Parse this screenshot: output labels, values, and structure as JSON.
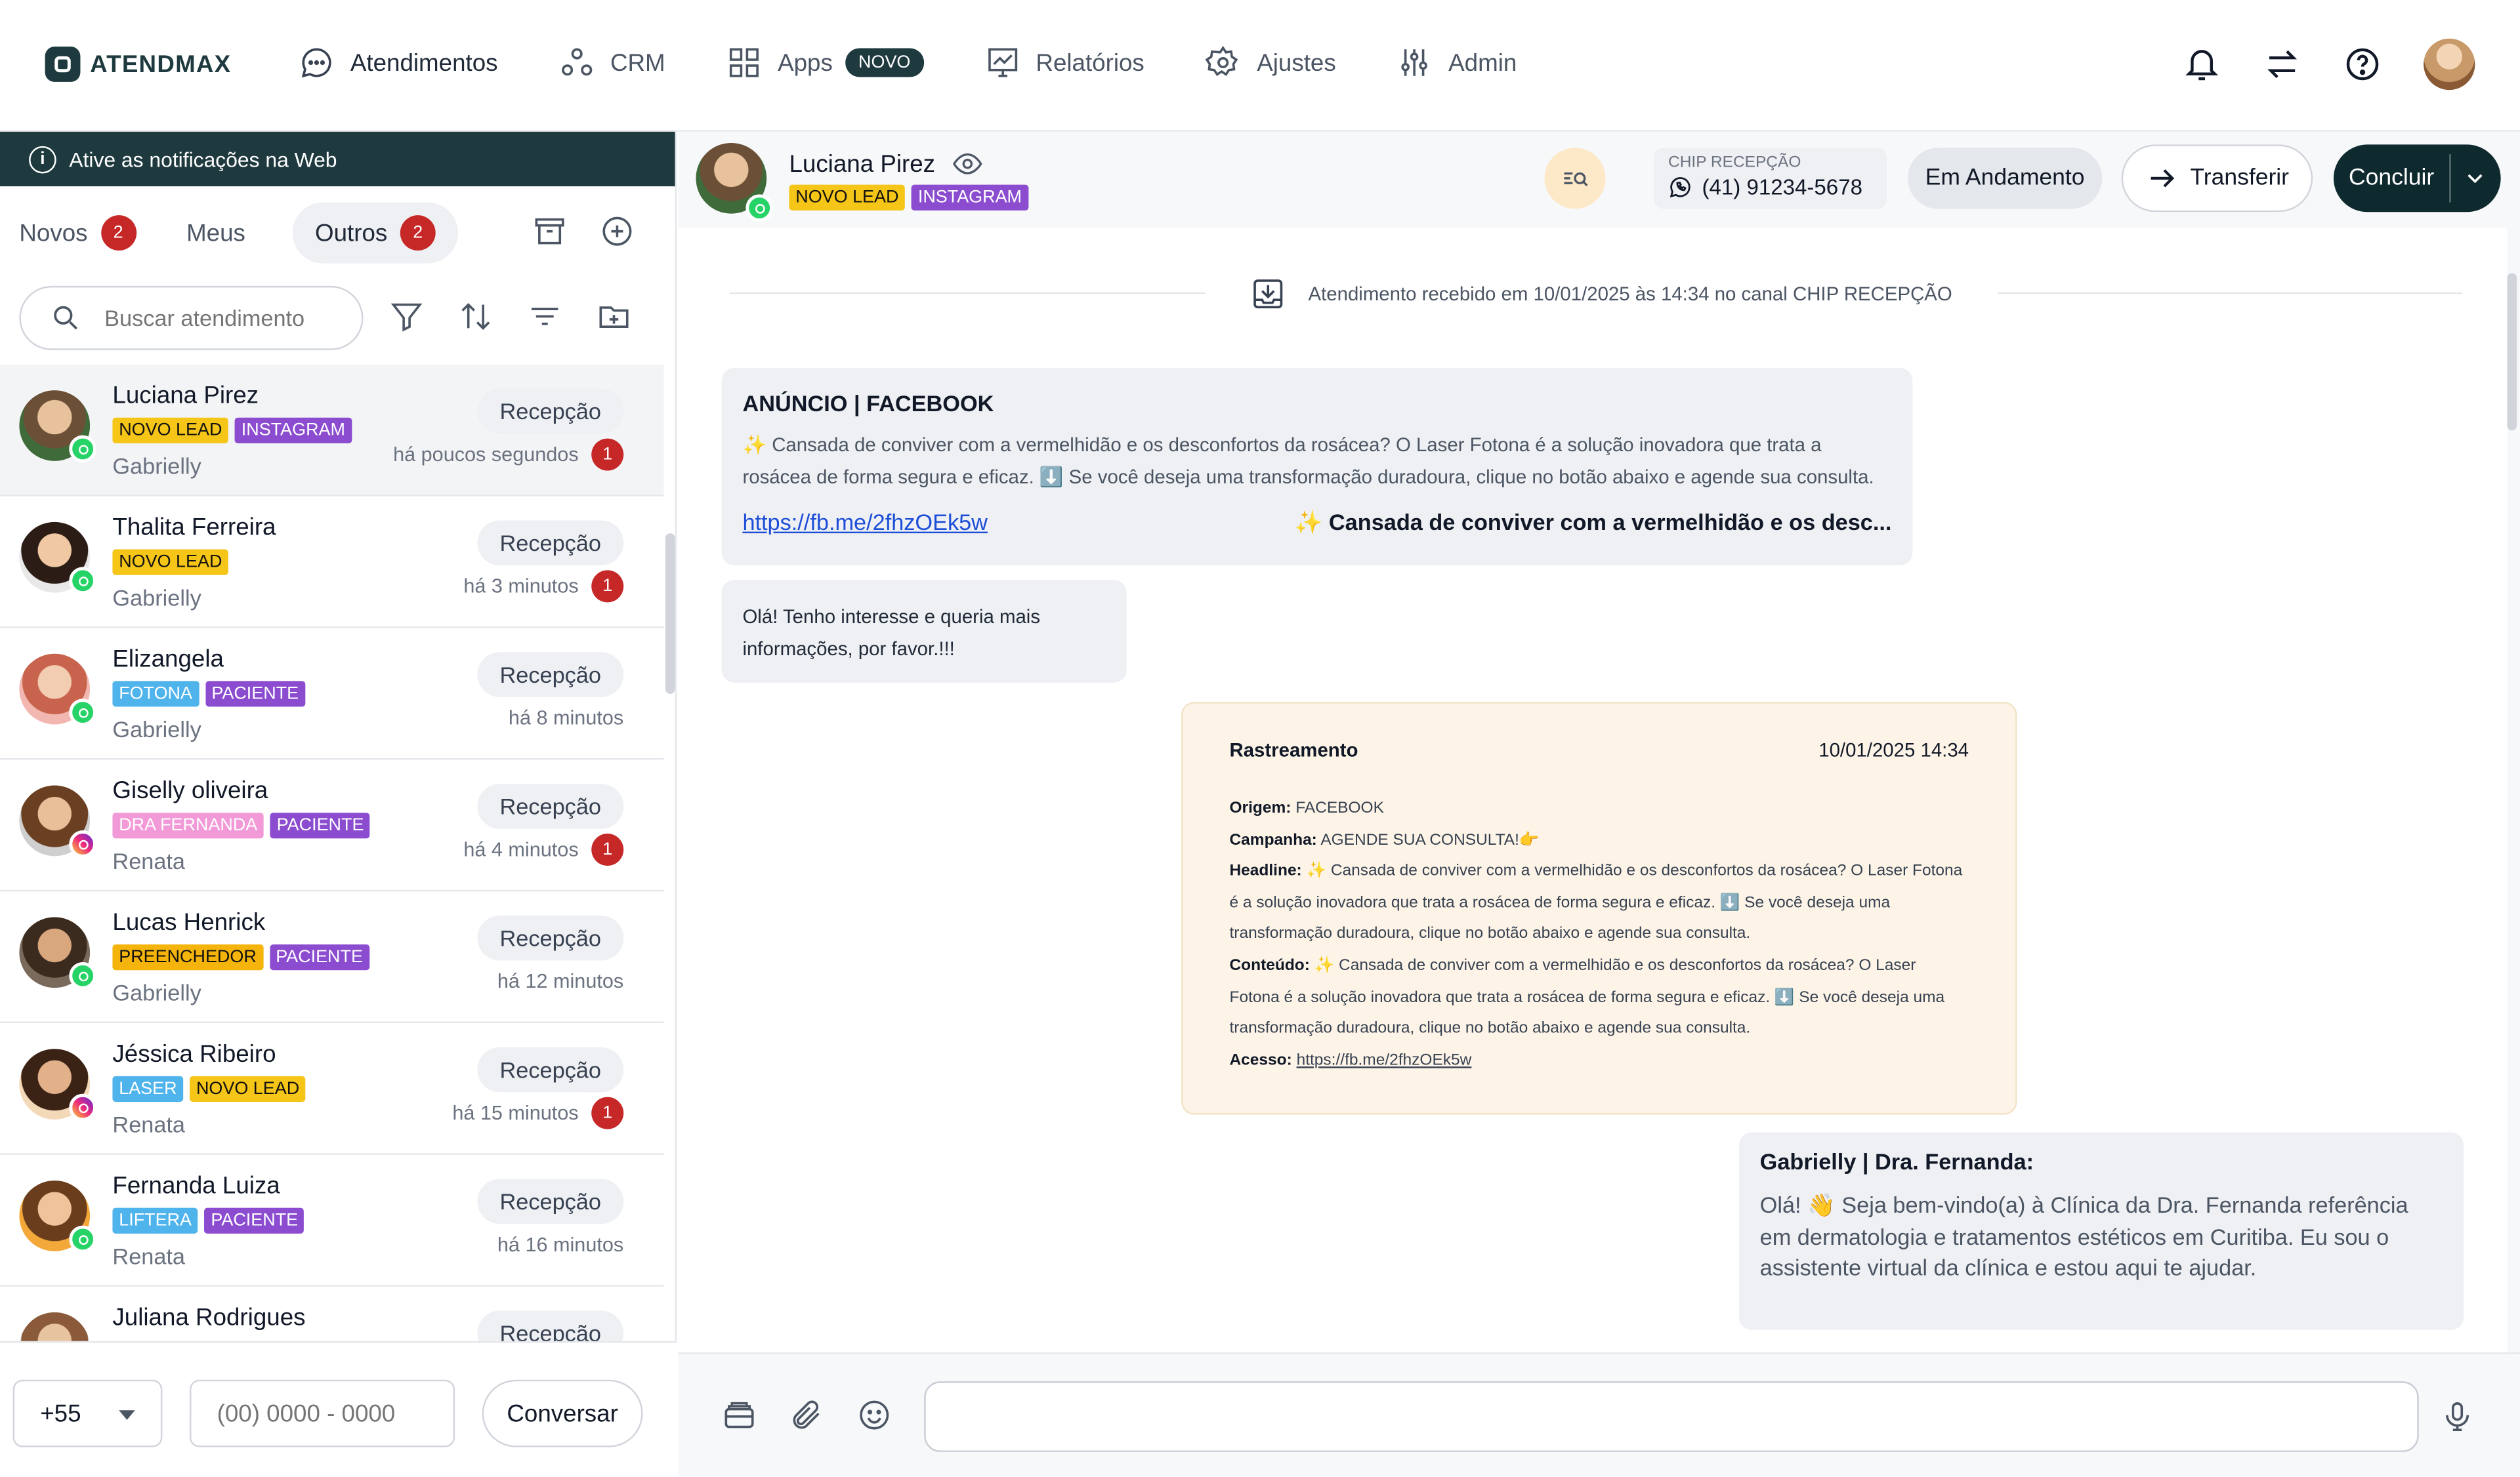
{
  "app": {
    "logo_text": "ATENDMAX"
  },
  "nav": {
    "items": [
      {
        "label": "Atendimentos",
        "icon": "chat-bubble-icon"
      },
      {
        "label": "CRM",
        "icon": "nodes-icon"
      },
      {
        "label": "Apps",
        "icon": "grid-icon",
        "badge": "NOVO"
      },
      {
        "label": "Relatórios",
        "icon": "chart-icon"
      },
      {
        "label": "Ajustes",
        "icon": "gear-icon"
      },
      {
        "label": "Admin",
        "icon": "sliders-icon"
      }
    ]
  },
  "left": {
    "notification": "Ative as notificações na Web",
    "tabs": [
      {
        "label": "Novos",
        "count": "2"
      },
      {
        "label": "Meus"
      },
      {
        "label": "Outros",
        "count": "2"
      }
    ],
    "search_placeholder": "Buscar atendimento",
    "conversations": [
      {
        "name": "Luciana Pirez",
        "tags": [
          "NOVO LEAD",
          "INSTAGRAM"
        ],
        "agent": "Gabrielly",
        "queue": "Recepção",
        "time": "há poucos segundos",
        "unread": "1",
        "channel": "whatsapp"
      },
      {
        "name": "Thalita Ferreira",
        "tags": [
          "NOVO LEAD"
        ],
        "agent": "Gabrielly",
        "queue": "Recepção",
        "time": "há 3 minutos",
        "unread": "1",
        "channel": "whatsapp"
      },
      {
        "name": "Elizangela",
        "tags": [
          "FOTONA",
          "PACIENTE"
        ],
        "agent": "Gabrielly",
        "queue": "Recepção",
        "time": "há 8 minutos",
        "unread": "",
        "channel": "whatsapp"
      },
      {
        "name": "Giselly oliveira",
        "tags": [
          "DRA FERNANDA",
          "PACIENTE"
        ],
        "agent": "Renata",
        "queue": "Recepção",
        "time": "há 4 minutos",
        "unread": "1",
        "channel": "instagram"
      },
      {
        "name": "Lucas Henrick",
        "tags": [
          "PREENCHEDOR",
          "PACIENTE"
        ],
        "agent": "Gabrielly",
        "queue": "Recepção",
        "time": "há 12 minutos",
        "unread": "",
        "channel": "whatsapp"
      },
      {
        "name": "Jéssica Ribeiro",
        "tags": [
          "LASER",
          "NOVO LEAD"
        ],
        "agent": "Renata",
        "queue": "Recepção",
        "time": "há 15 minutos",
        "unread": "1",
        "channel": "instagram"
      },
      {
        "name": "Fernanda Luiza",
        "tags": [
          "LIFTERA",
          "PACIENTE"
        ],
        "agent": "Renata",
        "queue": "Recepção",
        "time": "há 16 minutos",
        "unread": "",
        "channel": "whatsapp"
      },
      {
        "name": "Juliana Rodrigues",
        "tags": [],
        "agent": "",
        "queue": "Recepção",
        "time": "",
        "unread": "",
        "channel": "whatsapp"
      }
    ],
    "composer": {
      "ddi": "+55",
      "phone_placeholder": "(00) 0000 - 0000",
      "button": "Conversar"
    }
  },
  "chat": {
    "contact": {
      "name": "Luciana Pirez",
      "tags": [
        "NOVO LEAD",
        "INSTAGRAM"
      ]
    },
    "chip_label": "CHIP RECEPÇÃO",
    "chip_number": "(41) 91234-5678",
    "status": "Em Andamento",
    "transfer": "Transferir",
    "conclude": "Concluir",
    "system_message": "Atendimento recebido em 10/01/2025 às 14:34 no canal CHIP RECEPÇÃO",
    "ad": {
      "title": "ANÚNCIO | FACEBOOK",
      "body": "✨ Cansada de conviver com a vermelhidão e os desconfortos da rosácea? O Laser Fotona é a solução inovadora que trata a rosácea de forma segura e eficaz. ⬇️ Se você deseja uma transformação duradoura, clique no botão abaixo e agende sua consulta.",
      "link": "https://fb.me/2fhzOEk5w",
      "cta": "✨ Cansada de conviver com a vermelhidão e os desc..."
    },
    "incoming": "Olá! Tenho interesse e queria mais informações, por favor.!!!",
    "tracking": {
      "title": "Rastreamento",
      "datetime": "10/01/2025 14:34",
      "origem_label": "Origem:",
      "origem": "FACEBOOK",
      "campanha_label": "Campanha:",
      "campanha": "AGENDE SUA CONSULTA!👉",
      "headline_label": "Headline:",
      "headline": "✨ Cansada de conviver com a vermelhidão e os desconfortos da rosácea? O Laser Fotona é a solução inovadora que trata a rosácea de forma segura e eficaz. ⬇️ Se você deseja uma transformação duradoura, clique no botão abaixo e agende sua consulta.",
      "conteudo_label": "Conteúdo:",
      "conteudo": "✨ Cansada de conviver com a vermelhidão e os desconfortos da rosácea? O Laser Fotona é a solução inovadora que trata a rosácea de forma segura e eficaz. ⬇️ Se você deseja uma transformação duradoura, clique no botão abaixo e agende sua consulta.",
      "acesso_label": "Acesso:",
      "acesso": "https://fb.me/2fhzOEk5w"
    },
    "outgoing": {
      "title": "Gabrielly | Dra. Fernanda:",
      "body": "Olá! 👋 Seja bem-vindo(a) à Clínica da Dra. Fernanda referência em dermatologia e tratamentos estéticos em Curitiba. Eu sou o assistente virtual da clínica e estou aqui te ajudar."
    }
  },
  "colors": {
    "brand": "#1e3a3f",
    "unread": "#c62828",
    "tag_yellow": "#f5c518",
    "tag_purple": "#8b4ccf",
    "tag_blue": "#4fb3ec",
    "tag_pink": "#f29ad8",
    "tracking_bg": "#fdf4e7"
  }
}
